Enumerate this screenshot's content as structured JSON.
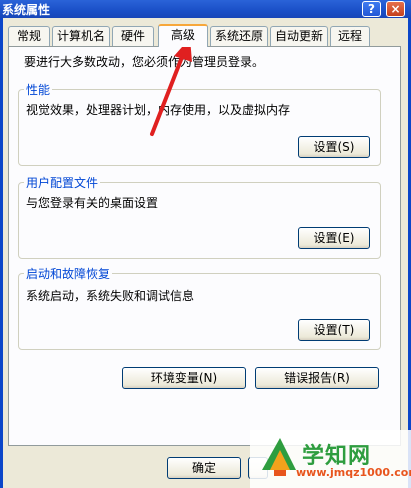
{
  "window": {
    "title": "系统属性",
    "help_label": "?",
    "close_label": "×"
  },
  "tabs": [
    {
      "label": "常规"
    },
    {
      "label": "计算机名"
    },
    {
      "label": "硬件"
    },
    {
      "label": "高级"
    },
    {
      "label": "系统还原"
    },
    {
      "label": "自动更新"
    },
    {
      "label": "远程"
    }
  ],
  "active_tab": "高级",
  "notice": "要进行大多数改动，您必须作为管理员登录。",
  "groups": {
    "performance": {
      "title": "性能",
      "desc": "视觉效果，处理器计划，内存使用，以及虚拟内存",
      "button": "设置(S)"
    },
    "profile": {
      "title": "用户配置文件",
      "desc": "与您登录有关的桌面设置",
      "button": "设置(E)"
    },
    "startup": {
      "title": "启动和故障恢复",
      "desc": "系统启动，系统失败和调试信息",
      "button": "设置(T)"
    }
  },
  "env_button": "环境变量(N)",
  "error_button": "错误报告(R)",
  "footer": {
    "ok_button": "确定"
  },
  "watermark": {
    "title": "学知网",
    "url": "www.jmqz1000.com"
  },
  "colors": {
    "title_bar": "#2a63d8",
    "annotation_arrow": "#e02020",
    "active_tab_accent": "#f7a73a"
  }
}
